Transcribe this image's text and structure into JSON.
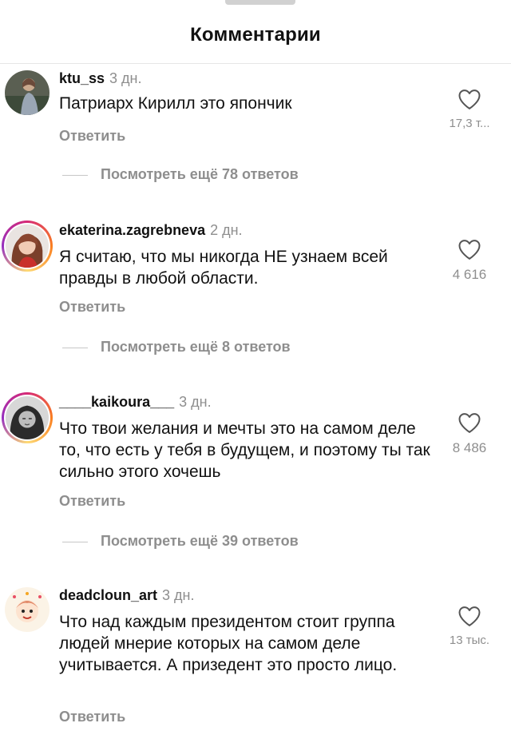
{
  "header": {
    "title": "Комментарии"
  },
  "comments": [
    {
      "username": "ktu_ss",
      "time": "3 дн.",
      "text": "Патриарх Кирилл это япончик",
      "reply_label": "Ответить",
      "likes": "17,3 т...",
      "more_replies": "Посмотреть ещё 78 ответов"
    },
    {
      "username": "ekaterina.zagrebneva",
      "time": "2 дн.",
      "text": "Я считаю, что мы никогда НЕ узнаем всей правды в любой области.",
      "reply_label": "Ответить",
      "likes": "4 616",
      "more_replies": "Посмотреть ещё 8 ответов"
    },
    {
      "username": "____kaikoura___",
      "time": "3 дн.",
      "text": "Что твои желания и мечты это на самом деле то, что есть у тебя в будущем, и поэтому ты так сильно этого хочешь",
      "reply_label": "Ответить",
      "likes": "8 486",
      "more_replies": "Посмотреть ещё 39 ответов"
    },
    {
      "username": "deadcloun_art",
      "time": "3 дн.",
      "text": "Что над каждым президентом  стоит группа людей мнерие которых на самом деле учитывается. А призедент это просто лицо.",
      "reply_label": "Ответить",
      "likes": "13 тыс."
    }
  ],
  "icons": {
    "like": "heart-outline-icon"
  },
  "colors": {
    "muted": "#8e8e8e",
    "story_ring": "#d62976",
    "divider": "#e6e6e6"
  }
}
